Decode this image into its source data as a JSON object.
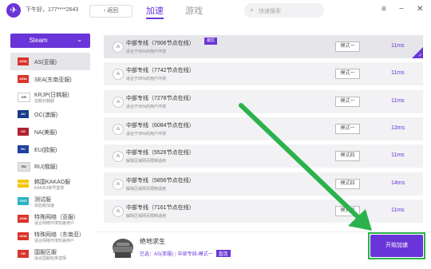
{
  "header": {
    "user": "下午好，177****2643",
    "back_label": "返回",
    "tabs": [
      "加速",
      "游戏"
    ],
    "search_placeholder": "快速搜索",
    "window_icons": [
      "menu-icon",
      "minimize-icon",
      "close-icon"
    ]
  },
  "sidebar": {
    "game_select": "Steam",
    "regions": [
      {
        "flag": "ASIA",
        "name": "AS(亚服)",
        "sub": ""
      },
      {
        "flag": "ASIA",
        "name": "SEA(东南亚服)",
        "sub": ""
      },
      {
        "flag": "KR",
        "name": "KRJP(日韩服)",
        "sub": "亚服日韩服"
      },
      {
        "flag": "AU",
        "name": "OC(澳服)",
        "sub": ""
      },
      {
        "flag": "US",
        "name": "NA(美服)",
        "sub": ""
      },
      {
        "flag": "EU",
        "name": "EU(欧服)",
        "sub": ""
      },
      {
        "flag": "RU",
        "name": "RU(俄服)",
        "sub": ""
      },
      {
        "flag": "KAKAO",
        "name": "韩国KAKAO服",
        "sub": "KAKAO账号登录"
      },
      {
        "flag": "TEST",
        "name": "测试服",
        "sub": "体验服加速"
      },
      {
        "flag": "ASIA",
        "name": "特殊网络（亚服）",
        "sub": "适合网络环境较差用户"
      },
      {
        "flag": "ASIA",
        "name": "特殊网络（东南亚）",
        "sub": "适合网络环境较差用户"
      },
      {
        "flag": "CN",
        "name": "国服区服",
        "sub": "适合国服玩家选择"
      }
    ]
  },
  "servers": [
    {
      "name": "中部专线（7906节点在线）",
      "desc": "适合于95%的用户环境",
      "badge": "最优",
      "mode": "模式一",
      "ping": "11ms"
    },
    {
      "name": "中部专线（7742节点在线）",
      "desc": "适合于95%的用户环境",
      "badge": "",
      "mode": "模式一",
      "ping": "11ms"
    },
    {
      "name": "中部专线（7278节点在线）",
      "desc": "适合于95%的用户环境",
      "badge": "",
      "mode": "模式一",
      "ping": "11ms"
    },
    {
      "name": "中部专线（6084节点在线）",
      "desc": "适合于95%的用户环境",
      "badge": "",
      "mode": "模式一",
      "ping": "12ms"
    },
    {
      "name": "中部专线（5526节点在线）",
      "desc": "解除区域网页限制适用",
      "badge": "",
      "mode": "模式四",
      "ping": "11ms"
    },
    {
      "name": "中部专线（5856节点在线）",
      "desc": "解除区域网页限制适用",
      "badge": "",
      "mode": "模式四",
      "ping": "14ms"
    },
    {
      "name": "中部专线（7161节点在线）",
      "desc": "解除区域网页限制适用",
      "badge": "",
      "mode": "模式四",
      "ping": "11ms"
    }
  ],
  "footer": {
    "game_title": "绝地求生",
    "region_label": "已选：AS(亚服)",
    "mode_label": "中部专线-模式一",
    "tag": "直连",
    "start_label": "开始加速"
  },
  "colors": {
    "accent": "#6a35d8",
    "highlight": "#2bb24c"
  }
}
